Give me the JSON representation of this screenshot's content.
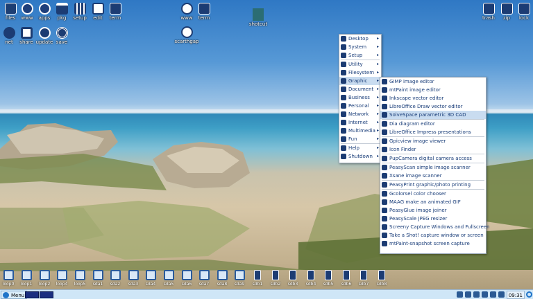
{
  "desktop_icons": [
    {
      "id": "files",
      "label": "files",
      "icon": "file-manager-icon"
    },
    {
      "id": "www",
      "label": "www",
      "icon": "globe-icon"
    },
    {
      "id": "apps",
      "label": "apps",
      "icon": "apps-grid-icon"
    },
    {
      "id": "pkg",
      "label": "pkg",
      "icon": "package-icon"
    },
    {
      "id": "setup",
      "label": "setup",
      "icon": "sliders-icon"
    },
    {
      "id": "edit",
      "label": "edit",
      "icon": "text-editor-icon"
    },
    {
      "id": "term",
      "label": "term",
      "icon": "terminal-icon"
    },
    {
      "id": "net",
      "label": "net",
      "icon": "network-icon"
    },
    {
      "id": "share",
      "label": "share",
      "icon": "share-icon"
    },
    {
      "id": "update",
      "label": "update",
      "icon": "update-icon"
    },
    {
      "id": "save",
      "label": "save",
      "icon": "save-icon"
    },
    {
      "id": "www2",
      "label": "www",
      "icon": "globe-dog-icon"
    },
    {
      "id": "term2",
      "label": "term",
      "icon": "terminal-icon"
    },
    {
      "id": "scarthgap",
      "label": "scarthgap",
      "icon": "puppy-dog-icon"
    },
    {
      "id": "shotcut",
      "label": "shotcut",
      "icon": "shotcut-icon"
    },
    {
      "id": "trash",
      "label": "trash",
      "icon": "trash-icon"
    },
    {
      "id": "zip",
      "label": "zip",
      "icon": "zip-icon"
    },
    {
      "id": "lock",
      "label": "lock",
      "icon": "lock-icon"
    }
  ],
  "main_menu": [
    {
      "label": "Desktop",
      "arrow": "▸"
    },
    {
      "label": "System",
      "arrow": "▸"
    },
    {
      "label": "Setup",
      "arrow": "▸"
    },
    {
      "label": "Utility",
      "arrow": "▸"
    },
    {
      "label": "Filesystem",
      "arrow": "▸"
    },
    {
      "label": "Graphic",
      "arrow": "▸",
      "selected": true
    },
    {
      "label": "Document",
      "arrow": "▸"
    },
    {
      "label": "Business",
      "arrow": "▸"
    },
    {
      "label": "Personal",
      "arrow": "▸"
    },
    {
      "label": "Network",
      "arrow": "▸"
    },
    {
      "label": "Internet",
      "arrow": "▸"
    },
    {
      "label": "Multimedia",
      "arrow": "▸"
    },
    {
      "label": "Fun",
      "arrow": "▸"
    },
    {
      "label": "Help",
      "arrow": "▸"
    },
    {
      "label": "Shutdown",
      "arrow": "▸"
    }
  ],
  "graphic_submenu": [
    {
      "label": "GIMP image editor"
    },
    {
      "label": "mtPaint image editor"
    },
    {
      "label": "Inkscape vector editor"
    },
    {
      "label": "LibreOffice Draw vector editor"
    },
    {
      "label": "SolveSpace parametric 3D CAD",
      "selected": true
    },
    {
      "label": "Dia diagram editor"
    },
    {
      "label": "LibreOffice Impress presentations"
    },
    {
      "label": "Gpicview image viewer"
    },
    {
      "label": "Icon Finder"
    },
    {
      "label": "PupCamera digital camera access"
    },
    {
      "label": "PeasyScan simple image scanner"
    },
    {
      "label": "Xsane image scanner"
    },
    {
      "label": "PeasyPrint graphic/photo printing"
    },
    {
      "label": "Gcolorsel color chooser"
    },
    {
      "label": "MAAG make an animated GIF"
    },
    {
      "label": "PeasyGlue image joiner"
    },
    {
      "label": "PeasyScale JPEG resizer"
    },
    {
      "label": "Screeny Capture Windows and Fullscreen"
    },
    {
      "label": "Take a Shot! capture window or screen"
    },
    {
      "label": "mtPaint-snapshot screen capture"
    }
  ],
  "drives": [
    "loop0",
    "loop1",
    "loop2",
    "loop4",
    "loop5",
    "sda1",
    "sda2",
    "sda3",
    "sda4",
    "sda5",
    "sda6",
    "sda7",
    "sda8",
    "sda9",
    "sdb1",
    "sdb2",
    "sdb3",
    "sdb4",
    "sdb5",
    "sdb6",
    "sdb7",
    "sdb8"
  ],
  "taskbar": {
    "menu_label": "Menu",
    "clock": "09:31"
  },
  "colors": {
    "menu_text": "#183c78",
    "selection": "#c9dcf0",
    "taskbar": "#cfe6f7"
  }
}
